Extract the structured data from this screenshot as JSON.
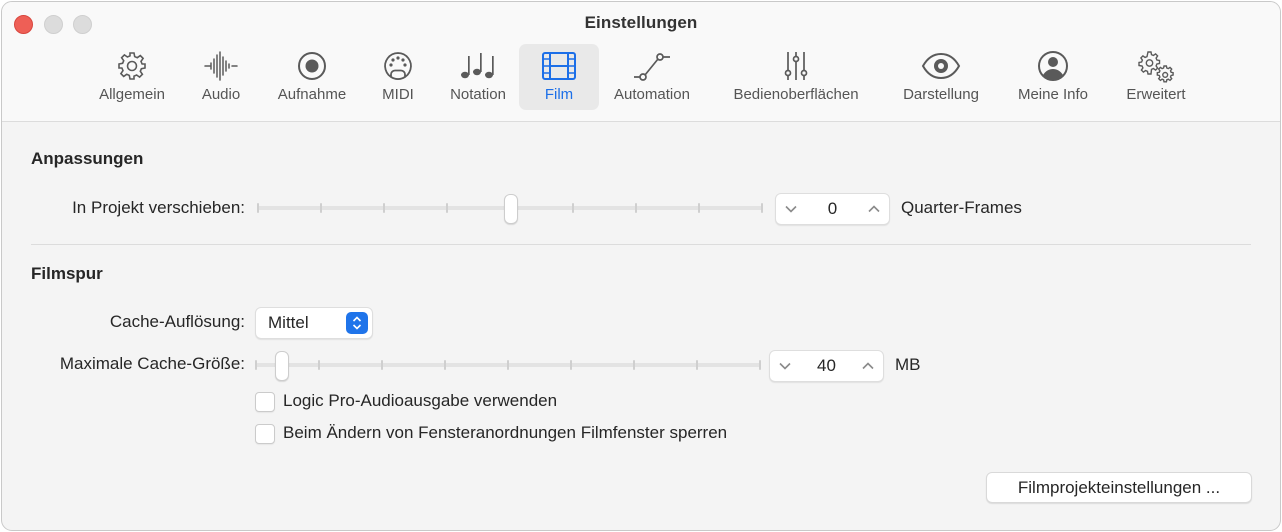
{
  "window": {
    "title": "Einstellungen",
    "controls": [
      "close",
      "minimize",
      "zoom"
    ]
  },
  "toolbar": {
    "tabs": [
      {
        "label": "Allgemein",
        "icon": "gear-icon",
        "active": false
      },
      {
        "label": "Audio",
        "icon": "waveform-icon",
        "active": false
      },
      {
        "label": "Aufnahme",
        "icon": "record-icon",
        "active": false
      },
      {
        "label": "MIDI",
        "icon": "midi-port-icon",
        "active": false
      },
      {
        "label": "Notation",
        "icon": "music-notes-icon",
        "active": false
      },
      {
        "label": "Film",
        "icon": "film-icon",
        "active": true
      },
      {
        "label": "Automation",
        "icon": "automation-curve-icon",
        "active": false
      },
      {
        "label": "Bedienoberflächen",
        "icon": "faders-icon",
        "active": false
      },
      {
        "label": "Darstellung",
        "icon": "eye-icon",
        "active": false
      },
      {
        "label": "Meine Info",
        "icon": "person-icon",
        "active": false
      },
      {
        "label": "Erweitert",
        "icon": "gears-icon",
        "active": false
      }
    ],
    "accent_color": "#1c6fe8"
  },
  "adjustments": {
    "title": "Anpassungen",
    "shift_label": "In Projekt verschieben:",
    "shift_slider_position": 0.5,
    "shift_value": "0",
    "shift_unit": "Quarter-Frames"
  },
  "movie_track": {
    "title": "Filmspur",
    "cache_resolution_label": "Cache-Auflösung:",
    "cache_resolution_value": "Mittel",
    "max_cache_label": "Maximale Cache-Größe:",
    "max_cache_slider_position": 0.04,
    "max_cache_value": "40",
    "max_cache_unit": "MB",
    "checkboxes": [
      {
        "label": "Logic Pro-Audioausgabe verwenden",
        "checked": false
      },
      {
        "label": "Beim Ändern von Fensteranordnungen Filmfenster sperren",
        "checked": false
      }
    ]
  },
  "footer": {
    "movie_project_settings_button": "Filmprojekteinstellungen ..."
  }
}
